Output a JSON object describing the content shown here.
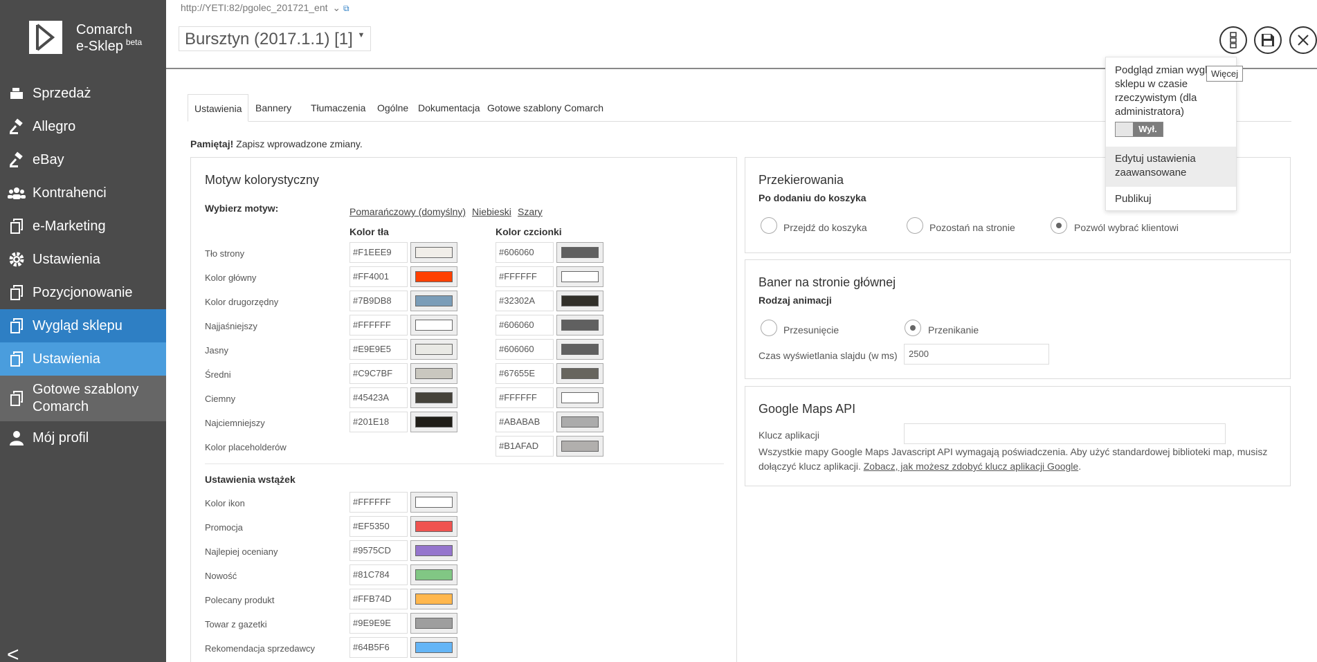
{
  "brand": {
    "line1": "Comarch",
    "line2": "e-Sklep",
    "badge": "beta"
  },
  "sidebar": {
    "items": [
      {
        "label": "Sprzedaż",
        "icon": "cash-register-icon"
      },
      {
        "label": "Allegro",
        "icon": "gavel-icon"
      },
      {
        "label": "eBay",
        "icon": "gavel-icon"
      },
      {
        "label": "Kontrahenci",
        "icon": "users-icon"
      },
      {
        "label": "e-Marketing",
        "icon": "documents-icon"
      },
      {
        "label": "Ustawienia",
        "icon": "gear-icon"
      },
      {
        "label": "Pozycjonowanie",
        "icon": "documents-icon"
      },
      {
        "label": "Wygląd sklepu",
        "icon": "documents-icon"
      },
      {
        "label": "Ustawienia",
        "icon": "documents-icon"
      },
      {
        "label": "Gotowe szablony Comarch",
        "icon": "documents-icon"
      },
      {
        "label": "Mój profil",
        "icon": "user-icon"
      }
    ],
    "collapse_glyph": "<"
  },
  "header": {
    "url": "http://YETI:82/pgolec_201721_ent",
    "store_select": "Bursztyn (2017.1.1) [1]"
  },
  "dropdown": {
    "preview_text": "Podgląd zmian wyglądu sklepu w czasie rzeczywistym (dla administratora)",
    "toggle_state": "Wył.",
    "items": [
      "Edytuj ustawienia zaawansowane",
      "Publikuj"
    ],
    "tooltip": "Więcej"
  },
  "tabs": [
    "Ustawienia",
    "Bannery",
    "Tłumaczenia",
    "Ogólne",
    "Dokumentacja",
    "Gotowe szablony Comarch"
  ],
  "reminder": {
    "bold": "Pamiętaj!",
    "text": " Zapisz wprowadzone zmiany."
  },
  "theme_panel": {
    "title": "Motyw kolorystyczny",
    "choose_label": "Wybierz motyw:",
    "themes": [
      "Pomarańczowy (domyślny)",
      "Niebieski",
      "Szary"
    ],
    "col_bg": "Kolor tła",
    "col_font": "Kolor czcionki",
    "rows": [
      {
        "label": "Tło strony",
        "bg": "#F1EEE9",
        "font": "#606060"
      },
      {
        "label": "Kolor główny",
        "bg": "#FF4001",
        "font": "#FFFFFF"
      },
      {
        "label": "Kolor drugorzędny",
        "bg": "#7B9DB8",
        "font": "#32302A"
      },
      {
        "label": "Najjaśniejszy",
        "bg": "#FFFFFF",
        "font": "#606060"
      },
      {
        "label": "Jasny",
        "bg": "#E9E9E5",
        "font": "#606060"
      },
      {
        "label": "Średni",
        "bg": "#C9C7BF",
        "font": "#67655E"
      },
      {
        "label": "Ciemny",
        "bg": "#45423A",
        "font": "#FFFFFF"
      },
      {
        "label": "Najciemniejszy",
        "bg": "#201E18",
        "font": "#ABABAB"
      },
      {
        "label": "Kolor placeholderów",
        "bg": null,
        "font": "#B1AFAD"
      }
    ],
    "ribbons_title": "Ustawienia wstążek",
    "ribbons": [
      {
        "label": "Kolor ikon",
        "color": "#FFFFFF"
      },
      {
        "label": "Promocja",
        "color": "#EF5350"
      },
      {
        "label": "Najlepiej oceniany",
        "color": "#9575CD"
      },
      {
        "label": "Nowość",
        "color": "#81C784"
      },
      {
        "label": "Polecany produkt",
        "color": "#FFB74D"
      },
      {
        "label": "Towar z gazetki",
        "color": "#9E9E9E"
      },
      {
        "label": "Rekomendacja sprzedawcy",
        "color": "#64B5F6"
      }
    ]
  },
  "redirect_panel": {
    "title": "Przekierowania",
    "subtitle": "Po dodaniu do koszyka",
    "options": [
      {
        "label": "Przejdź do koszyka",
        "selected": false
      },
      {
        "label": "Pozostań na stronie",
        "selected": false
      },
      {
        "label": "Pozwól wybrać klientowi",
        "selected": true
      }
    ]
  },
  "banner_panel": {
    "title": "Baner na stronie głównej",
    "subtitle": "Rodzaj animacji",
    "options": [
      {
        "label": "Przesunięcie",
        "selected": false
      },
      {
        "label": "Przenikanie",
        "selected": true
      }
    ],
    "slide_time_label": "Czas wyświetlania slajdu (w ms)",
    "slide_time_value": "2500"
  },
  "maps_panel": {
    "title": "Google Maps API",
    "key_label": "Klucz aplikacji",
    "key_value": "",
    "note": "Wszystkie mapy Google Maps Javascript API wymagają poświadczenia. Aby użyć standardowej biblioteki map, musisz dołączyć klucz aplikacji. ",
    "link": "Zobacz, jak możesz zdobyć klucz aplikacji Google",
    "note_end": "."
  },
  "colors": {
    "sidebar_bg": "#4b4b4b",
    "active_primary": "#2e7fc4",
    "active_secondary": "#4a9ddd"
  }
}
